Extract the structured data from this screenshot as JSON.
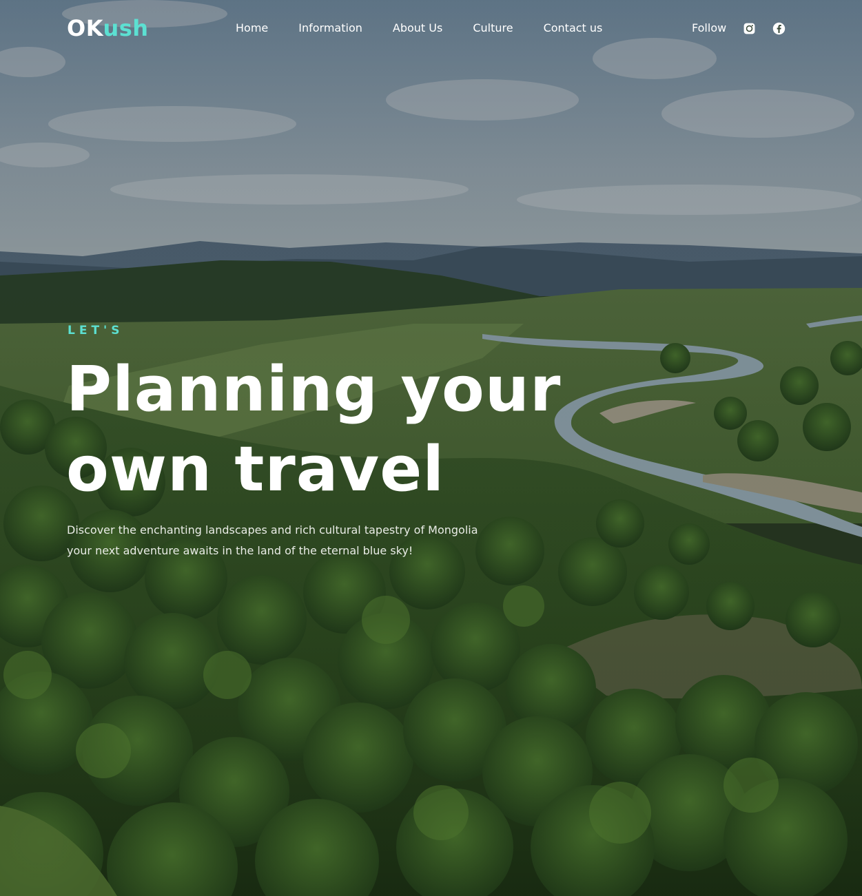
{
  "brand": {
    "logo_main": "OK",
    "logo_accent": "ush"
  },
  "nav": {
    "items": [
      {
        "label": "Home"
      },
      {
        "label": "Information"
      },
      {
        "label": "About Us"
      },
      {
        "label": "Culture"
      },
      {
        "label": "Contact us"
      }
    ],
    "follow_label": "Follow",
    "social": [
      {
        "icon": "instagram-icon"
      },
      {
        "icon": "facebook-icon"
      }
    ]
  },
  "hero": {
    "eyebrow": "LET'S",
    "headline_line1": "Planning your",
    "headline_line2": "own travel",
    "description_line1": "Discover the enchanting landscapes and rich cultural tapestry of Mongolia",
    "description_line2": "your next adventure awaits in the land of the eternal blue sky!"
  },
  "colors": {
    "accent": "#5ce0d2",
    "text": "#ffffff"
  }
}
